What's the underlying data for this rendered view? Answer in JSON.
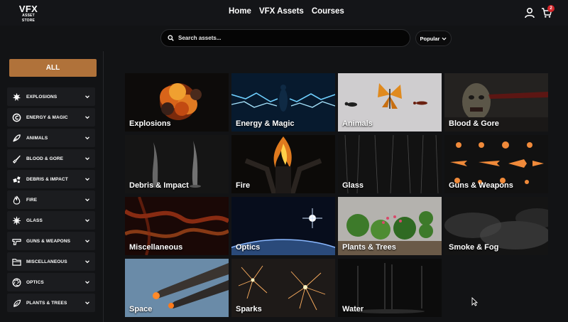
{
  "logo": {
    "main": "VFX",
    "sub": "ASSET STORE"
  },
  "nav": {
    "items": [
      "Home",
      "VFX Assets",
      "Courses"
    ]
  },
  "cart": {
    "count": "2"
  },
  "search": {
    "placeholder": "Search assets..."
  },
  "sort": {
    "label": "Popular"
  },
  "sidebar": {
    "all_label": "ALL",
    "items": [
      {
        "label": "EXPLOSIONS",
        "icon": "explosion-icon"
      },
      {
        "label": "ENERGY & MAGIC",
        "icon": "energy-icon"
      },
      {
        "label": "ANIMALS",
        "icon": "feather-icon"
      },
      {
        "label": "BLOOD & GORE",
        "icon": "knife-icon"
      },
      {
        "label": "DEBRIS & IMPACT",
        "icon": "debris-icon"
      },
      {
        "label": "FIRE",
        "icon": "flame-icon"
      },
      {
        "label": "GLASS",
        "icon": "glass-icon"
      },
      {
        "label": "GUNS & WEAPONS",
        "icon": "gun-icon"
      },
      {
        "label": "MISCELLANEOUS",
        "icon": "folder-icon"
      },
      {
        "label": "OPTICS",
        "icon": "aperture-icon"
      },
      {
        "label": "PLANTS & TREES",
        "icon": "leaf-icon"
      }
    ]
  },
  "categories": [
    "Explosions",
    "Energy & Magic",
    "Animals",
    "Blood & Gore",
    "Debris & Impact",
    "Fire",
    "Glass",
    "Guns & Weapons",
    "Miscellaneous",
    "Optics",
    "Plants & Trees",
    "Smoke & Fog",
    "Space",
    "Sparks",
    "Water"
  ],
  "colors": {
    "accent": "#b0723a",
    "badge": "#d4262a",
    "background": "#121315"
  }
}
